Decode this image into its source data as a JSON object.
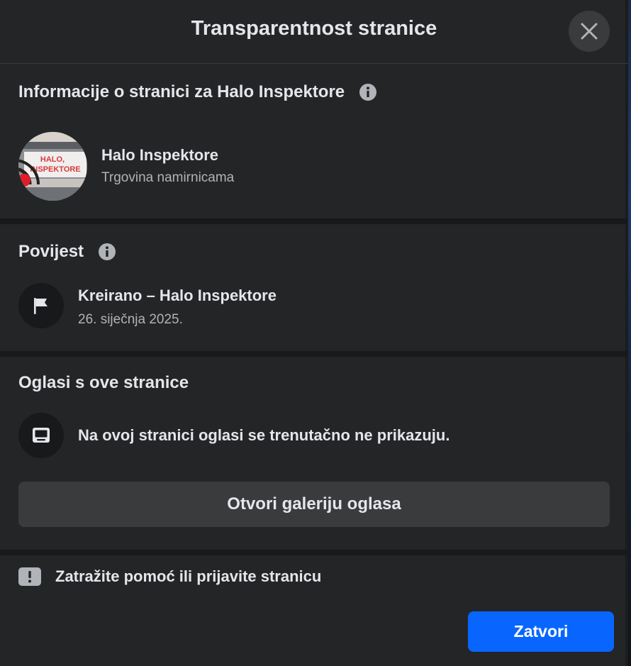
{
  "dialog": {
    "title": "Transparentnost stranice",
    "close_icon": "close-icon"
  },
  "page_info": {
    "heading": "Informacije o stranici za Halo Inspektore",
    "name": "Halo Inspektore",
    "category": "Trgovina namirnicama",
    "avatar_text": "HALO, INSPEKTORE"
  },
  "history": {
    "heading": "Povijest",
    "event_title": "Kreirano – Halo Inspektore",
    "event_date": "26. siječnja 2025.",
    "icon": "flag-icon"
  },
  "ads": {
    "heading": "Oglasi s ove stranice",
    "status_text": "Na ovoj stranici oglasi se trenutačno ne prikazuju.",
    "gallery_button": "Otvori galeriju oglasa",
    "icon": "ad-screen-icon"
  },
  "footer": {
    "report_label": "Zatražite pomoć ili prijavite stranicu",
    "close_button": "Zatvori"
  },
  "colors": {
    "background": "#242526",
    "divider": "#18191a",
    "primary": "#0866ff",
    "secondary_button": "#3a3b3c",
    "text_primary": "#e4e6eb",
    "text_secondary": "#b0b3b8"
  }
}
